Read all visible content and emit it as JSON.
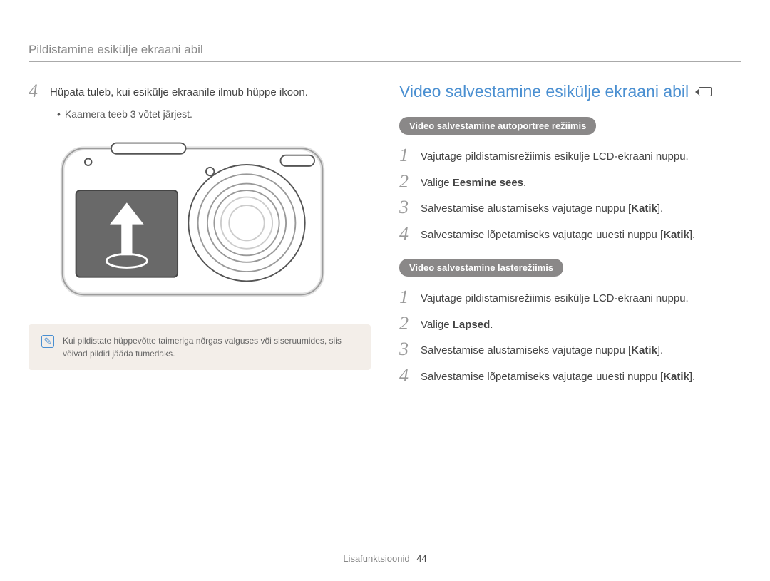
{
  "header": "Pildistamine esikülje ekraani abil",
  "left": {
    "step4_num": "4",
    "step4_text": "Hüpata tuleb, kui esikülje ekraanile ilmub hüppe ikoon.",
    "bullet": "Kaamera teeb 3 võtet järjest.",
    "note": "Kui pildistate hüppevõtte taimeriga nõrgas valguses või siseruumides, siis võivad pildid jääda tumedaks."
  },
  "right": {
    "title": "Video salvestamine esikülje ekraani abil",
    "sectionA": {
      "pill": "Video salvestamine autoportree režiimis",
      "s1_num": "1",
      "s1_text": "Vajutage pildistamisrežiimis esikülje LCD-ekraani nuppu.",
      "s2_num": "2",
      "s2_pre": "Valige ",
      "s2_bold": "Eesmine sees",
      "s2_post": ".",
      "s3_num": "3",
      "s3_pre": "Salvestamise alustamiseks vajutage nuppu [",
      "s3_bold": "Katik",
      "s3_post": "].",
      "s4_num": "4",
      "s4_pre": "Salvestamise lõpetamiseks vajutage uuesti nuppu [",
      "s4_bold": "Katik",
      "s4_post": "]."
    },
    "sectionB": {
      "pill": "Video salvestamine lasterežiimis",
      "s1_num": "1",
      "s1_text": "Vajutage pildistamisrežiimis esikülje LCD-ekraani nuppu.",
      "s2_num": "2",
      "s2_pre": "Valige ",
      "s2_bold": "Lapsed",
      "s2_post": ".",
      "s3_num": "3",
      "s3_pre": "Salvestamise alustamiseks vajutage nuppu [",
      "s3_bold": "Katik",
      "s3_post": "].",
      "s4_num": "4",
      "s4_pre": "Salvestamise lõpetamiseks vajutage uuesti nuppu [",
      "s4_bold": "Katik",
      "s4_post": "]."
    }
  },
  "footer": {
    "label": "Lisafunktsioonid",
    "page": "44"
  }
}
